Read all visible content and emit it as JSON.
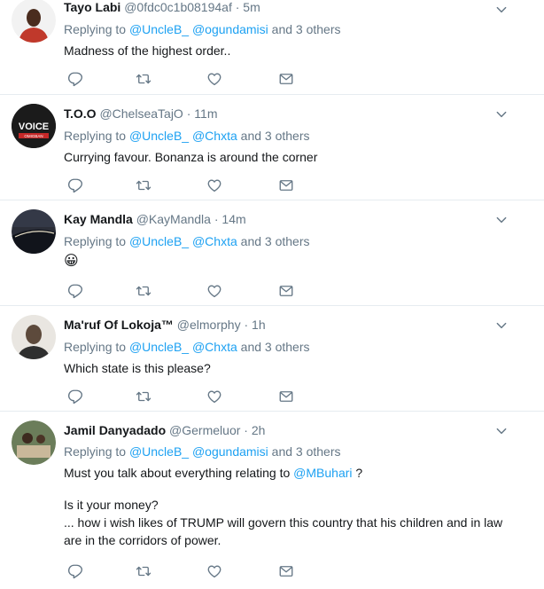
{
  "tweets": [
    {
      "name": "Tayo Labi",
      "handle": "@0fdc0c1b08194af",
      "time": "5m",
      "reply_prefix": "Replying to",
      "mention1": "@UncleB_",
      "mention2": "@ogundamisi",
      "reply_suffix": "and 3 others",
      "text": "Madness of the highest order..",
      "avatar_color": "#c0392b"
    },
    {
      "name": "T.O.O",
      "handle": "@ChelseaTajO",
      "time": "11m",
      "reply_prefix": "Replying to",
      "mention1": "@UncleB_",
      "mention2": "@Chxta",
      "reply_suffix": "and 3 others",
      "text": "Currying favour. Bonanza is around the corner",
      "avatar_label": "VOICE",
      "avatar_sublabel": "OMIGBAN",
      "avatar_color": "#1b1b1b"
    },
    {
      "name": "Kay Mandla",
      "handle": "@KayMandla",
      "time": "14m",
      "reply_prefix": "Replying to",
      "mention1": "@UncleB_",
      "mention2": "@Chxta",
      "reply_suffix": "and 3 others",
      "text": "😀",
      "avatar_color": "#2b2e38"
    },
    {
      "name": "Ma'ruf Of Lokoja™",
      "handle": "@elmorphy",
      "time": "1h",
      "reply_prefix": "Replying to",
      "mention1": "@UncleB_",
      "mention2": "@Chxta",
      "reply_suffix": "and 3 others",
      "text": "Which state is this please?",
      "avatar_color": "#5d4a3c"
    },
    {
      "name": "Jamil Danyadado",
      "handle": "@Germeluor",
      "time": "2h",
      "reply_prefix": "Replying to",
      "mention1": "@UncleB_",
      "mention2": "@ogundamisi",
      "reply_suffix": "and 3 others",
      "text_line1_prefix": "Must you talk about everything relating to",
      "text_line1_mention": "@MBuhari",
      "text_line1_suffix": "?",
      "text_line2": "Is it your money?",
      "text_line3": "... how i wish likes of TRUMP will govern this country that his children and in law",
      "text_line4": "are in the corridors of power.",
      "avatar_color": "#6b7d5a"
    }
  ],
  "dot": "·",
  "icons": {
    "reply": "reply-icon",
    "retweet": "retweet-icon",
    "like": "heart-icon",
    "dm": "envelope-icon",
    "more": "chevron-down-icon"
  },
  "colors": {
    "link": "#1da1f2",
    "muted": "#657786",
    "text": "#14171a",
    "divider": "#e6ecf0"
  }
}
